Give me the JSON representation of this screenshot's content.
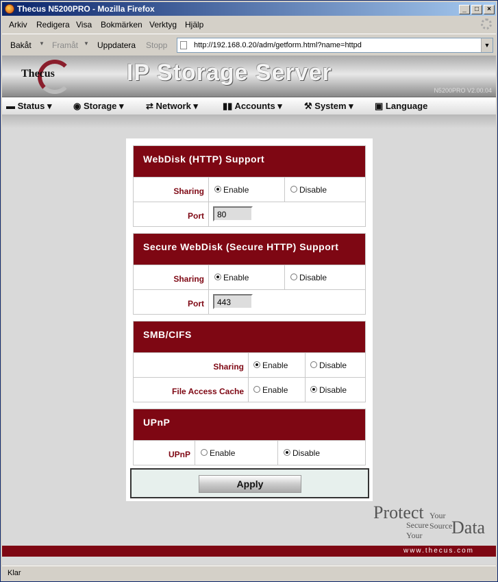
{
  "window": {
    "title": "Thecus N5200PRO - Mozilla Firefox"
  },
  "menu": [
    "Arkiv",
    "Redigera",
    "Visa",
    "Bokmärken",
    "Verktyg",
    "Hjälp"
  ],
  "nav": {
    "back": "Bakåt",
    "forward": "Framåt",
    "reload": "Uppdatera",
    "stop": "Stopp",
    "url": "http://192.168.0.20/adm/getform.html?name=httpd"
  },
  "header": {
    "logo": "Thecus",
    "banner": "IP Storage Server",
    "model": "N5200PRO V2.00.04"
  },
  "mainnav": [
    "Status",
    "Storage",
    "Network",
    "Accounts",
    "System",
    "Language"
  ],
  "sections": [
    {
      "title": "WebDisk (HTTP) Support",
      "rows": [
        {
          "label": "Sharing",
          "options": [
            "Enable",
            "Disable"
          ],
          "selected": "Enable"
        },
        {
          "label": "Port",
          "value": "80"
        }
      ]
    },
    {
      "title": "Secure WebDisk (Secure HTTP) Support",
      "rows": [
        {
          "label": "Sharing",
          "options": [
            "Enable",
            "Disable"
          ],
          "selected": "Enable"
        },
        {
          "label": "Port",
          "value": "443"
        }
      ]
    },
    {
      "title": "SMB/CIFS",
      "rows": [
        {
          "label": "Sharing",
          "options": [
            "Enable",
            "Disable"
          ],
          "selected": "Enable"
        },
        {
          "label": "File Access Cache",
          "options": [
            "Enable",
            "Disable"
          ],
          "selected": "Disable"
        }
      ]
    },
    {
      "title": "UPnP",
      "rows": [
        {
          "label": "UPnP",
          "options": [
            "Enable",
            "Disable"
          ],
          "selected": "Disable"
        }
      ]
    }
  ],
  "apply": "Apply",
  "slogan": {
    "protect": "Protect",
    "your_source": "Your Source",
    "secure_your": "Secure Your",
    "data": "Data"
  },
  "footer": "www.thecus.com",
  "status": "Klar"
}
